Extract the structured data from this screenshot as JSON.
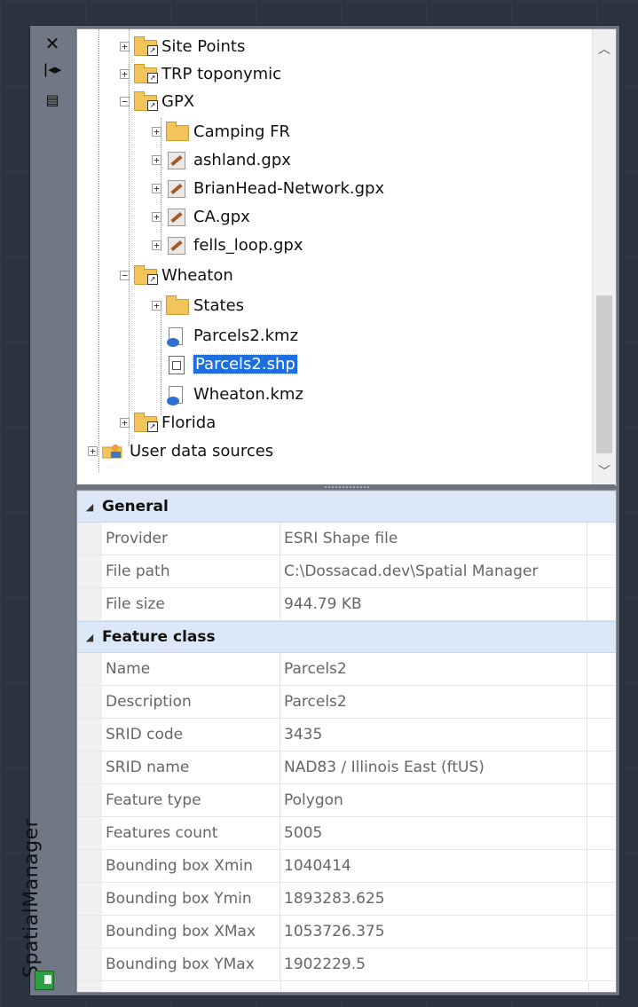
{
  "palette": {
    "title": "SpatialManager",
    "strip_icons": [
      "close-icon",
      "auto-hide-icon",
      "properties-icon"
    ]
  },
  "tree": {
    "items": [
      {
        "label": "Site Points",
        "icon": "folder-shortcut",
        "expander": "+"
      },
      {
        "label": "TRP toponymic",
        "icon": "folder-shortcut",
        "expander": "+"
      },
      {
        "label": "GPX",
        "icon": "folder-shortcut",
        "expander": "−"
      },
      {
        "label": "Camping FR",
        "icon": "folder",
        "expander": "+"
      },
      {
        "label": "ashland.gpx",
        "icon": "gpx-file",
        "expander": "+"
      },
      {
        "label": "BrianHead-Network.gpx",
        "icon": "gpx-file",
        "expander": "+"
      },
      {
        "label": "CA.gpx",
        "icon": "gpx-file",
        "expander": "+"
      },
      {
        "label": "fells_loop.gpx",
        "icon": "gpx-file",
        "expander": "+"
      },
      {
        "label": "Wheaton",
        "icon": "folder-shortcut",
        "expander": "−"
      },
      {
        "label": "States",
        "icon": "folder",
        "expander": "+"
      },
      {
        "label": "Parcels2.kmz",
        "icon": "kmz-file",
        "expander": ""
      },
      {
        "label": "Parcels2.shp",
        "icon": "shp-file",
        "expander": "",
        "selected": true
      },
      {
        "label": "Wheaton.kmz",
        "icon": "kmz-file",
        "expander": ""
      },
      {
        "label": "Florida",
        "icon": "folder-shortcut",
        "expander": "+"
      },
      {
        "label": "User data sources",
        "icon": "user-folder",
        "expander": "+"
      }
    ]
  },
  "properties": {
    "general": {
      "label": "General",
      "rows": [
        {
          "name": "Provider",
          "value": "ESRI Shape file"
        },
        {
          "name": "File path",
          "value": "C:\\Dossacad.dev\\Spatial Manager"
        },
        {
          "name": "File size",
          "value": "944.79 KB"
        }
      ]
    },
    "feature_class": {
      "label": "Feature class",
      "rows": [
        {
          "name": "Name",
          "value": "Parcels2"
        },
        {
          "name": "Description",
          "value": "Parcels2"
        },
        {
          "name": "SRID code",
          "value": "3435"
        },
        {
          "name": "SRID name",
          "value": "NAD83 / Illinois East (ftUS)"
        },
        {
          "name": "Feature type",
          "value": "Polygon"
        },
        {
          "name": "Features count",
          "value": "5005"
        },
        {
          "name": "Bounding box Xmin",
          "value": "1040414"
        },
        {
          "name": "Bounding box Ymin",
          "value": "1893283.625"
        },
        {
          "name": "Bounding box XMax",
          "value": "1053726.375"
        },
        {
          "name": "Bounding box YMax",
          "value": "1902229.5"
        }
      ]
    }
  },
  "colors": {
    "selection": "#1d6fe0",
    "category_bg": "#dce8f7",
    "folder": "#f2c55c"
  }
}
